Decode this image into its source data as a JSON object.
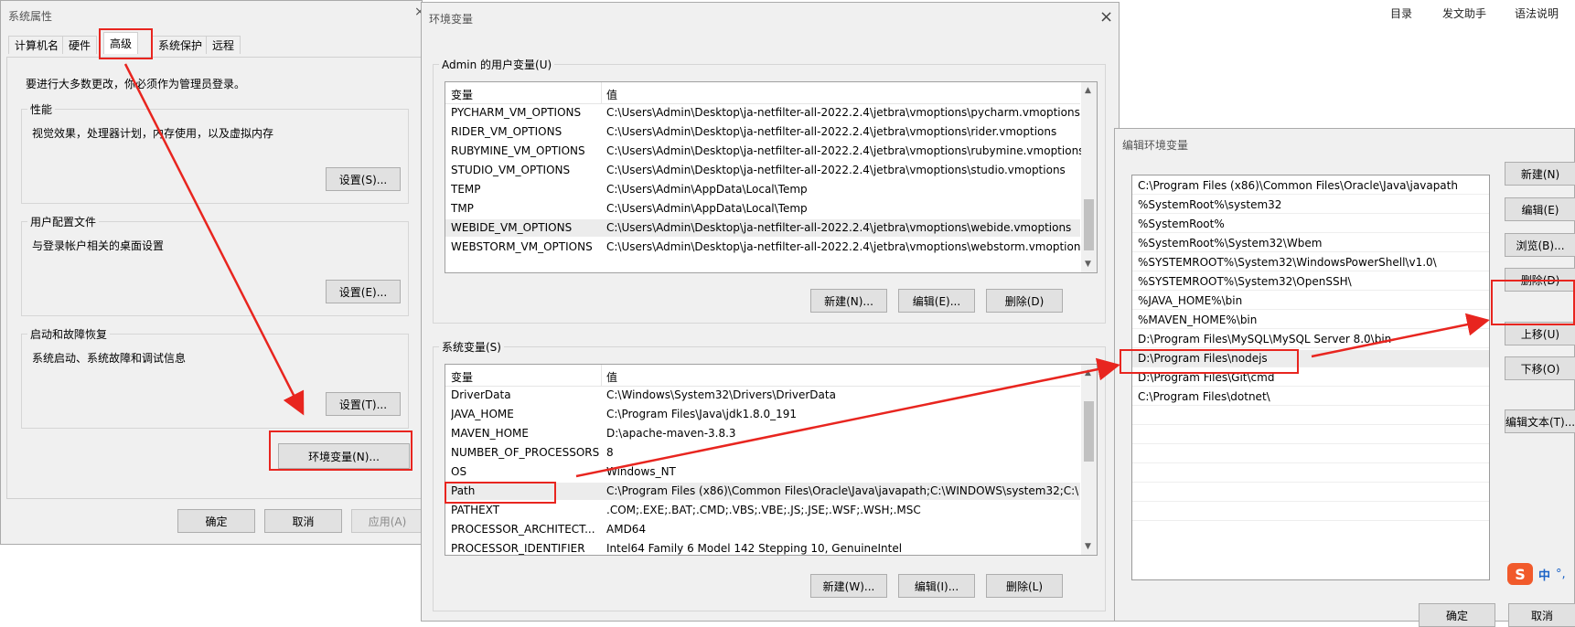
{
  "background_toolbar": {
    "items": [
      "目录",
      "发文助手",
      "语法说明"
    ]
  },
  "sys_props": {
    "title": "系统属性",
    "tabs": [
      "计算机名",
      "硬件",
      "高级",
      "系统保护",
      "远程"
    ],
    "notice": "要进行大多数更改，你必须作为管理员登录。",
    "performance": {
      "title": "性能",
      "desc": "视觉效果，处理器计划，内存使用，以及虚拟内存",
      "button": "设置(S)..."
    },
    "user_profile": {
      "title": "用户配置文件",
      "desc": "与登录帐户相关的桌面设置",
      "button": "设置(E)..."
    },
    "startup": {
      "title": "启动和故障恢复",
      "desc": "系统启动、系统故障和调试信息",
      "button": "设置(T)..."
    },
    "env_button": "环境变量(N)...",
    "ok": "确定",
    "cancel": "取消",
    "apply": "应用(A)"
  },
  "env_vars": {
    "title": "环境变量",
    "user_group_title": "Admin 的用户变量(U)",
    "col_var": "变量",
    "col_value": "值",
    "user_rows": [
      {
        "name": "PYCHARM_VM_OPTIONS",
        "value": "C:\\Users\\Admin\\Desktop\\ja-netfilter-all-2022.2.4\\jetbra\\vmoptions\\pycharm.vmoptions"
      },
      {
        "name": "RIDER_VM_OPTIONS",
        "value": "C:\\Users\\Admin\\Desktop\\ja-netfilter-all-2022.2.4\\jetbra\\vmoptions\\rider.vmoptions"
      },
      {
        "name": "RUBYMINE_VM_OPTIONS",
        "value": "C:\\Users\\Admin\\Desktop\\ja-netfilter-all-2022.2.4\\jetbra\\vmoptions\\rubymine.vmoptions"
      },
      {
        "name": "STUDIO_VM_OPTIONS",
        "value": "C:\\Users\\Admin\\Desktop\\ja-netfilter-all-2022.2.4\\jetbra\\vmoptions\\studio.vmoptions"
      },
      {
        "name": "TEMP",
        "value": "C:\\Users\\Admin\\AppData\\Local\\Temp"
      },
      {
        "name": "TMP",
        "value": "C:\\Users\\Admin\\AppData\\Local\\Temp"
      },
      {
        "name": "WEBIDE_VM_OPTIONS",
        "value": "C:\\Users\\Admin\\Desktop\\ja-netfilter-all-2022.2.4\\jetbra\\vmoptions\\webide.vmoptions"
      },
      {
        "name": "WEBSTORM_VM_OPTIONS",
        "value": "C:\\Users\\Admin\\Desktop\\ja-netfilter-all-2022.2.4\\jetbra\\vmoptions\\webstorm.vmoptions"
      }
    ],
    "user_buttons": {
      "new": "新建(N)...",
      "edit": "编辑(E)...",
      "delete": "删除(D)"
    },
    "sys_group_title": "系统变量(S)",
    "sys_rows": [
      {
        "name": "DriverData",
        "value": "C:\\Windows\\System32\\Drivers\\DriverData"
      },
      {
        "name": "JAVA_HOME",
        "value": "C:\\Program Files\\Java\\jdk1.8.0_191"
      },
      {
        "name": "MAVEN_HOME",
        "value": "D:\\apache-maven-3.8.3"
      },
      {
        "name": "NUMBER_OF_PROCESSORS",
        "value": "8"
      },
      {
        "name": "OS",
        "value": "Windows_NT"
      },
      {
        "name": "Path",
        "value": "C:\\Program Files (x86)\\Common Files\\Oracle\\Java\\javapath;C:\\WINDOWS\\system32;C:\\..."
      },
      {
        "name": "PATHEXT",
        "value": ".COM;.EXE;.BAT;.CMD;.VBS;.VBE;.JS;.JSE;.WSF;.WSH;.MSC"
      },
      {
        "name": "PROCESSOR_ARCHITECT...",
        "value": "AMD64"
      },
      {
        "name": "PROCESSOR_IDENTIFIER",
        "value": "Intel64 Family 6 Model 142 Stepping 10, GenuineIntel"
      }
    ],
    "sys_buttons": {
      "new": "新建(W)...",
      "edit": "编辑(I)...",
      "delete": "删除(L)"
    }
  },
  "edit_env": {
    "title": "编辑环境变量",
    "entries": [
      "C:\\Program Files (x86)\\Common Files\\Oracle\\Java\\javapath",
      "%SystemRoot%\\system32",
      "%SystemRoot%",
      "%SystemRoot%\\System32\\Wbem",
      "%SYSTEMROOT%\\System32\\WindowsPowerShell\\v1.0\\",
      "%SYSTEMROOT%\\System32\\OpenSSH\\",
      "%JAVA_HOME%\\bin",
      "%MAVEN_HOME%\\bin",
      "D:\\Program Files\\MySQL\\MySQL Server 8.0\\bin",
      "D:\\Program Files\\nodejs",
      "D:\\Program Files\\Git\\cmd",
      "C:\\Program Files\\dotnet\\"
    ],
    "buttons": {
      "new": "新建(N)",
      "edit": "编辑(E)",
      "browse": "浏览(B)...",
      "delete": "删除(D)",
      "up": "上移(U)",
      "down": "下移(O)",
      "edit_text": "编辑文本(T)..."
    },
    "ok": "确定",
    "cancel": "取消"
  },
  "ime": {
    "logo": "S",
    "mode": "中",
    "punct": "°,"
  },
  "colors": {
    "annotation": "#e8251f",
    "selection": "#e5f0ff"
  }
}
